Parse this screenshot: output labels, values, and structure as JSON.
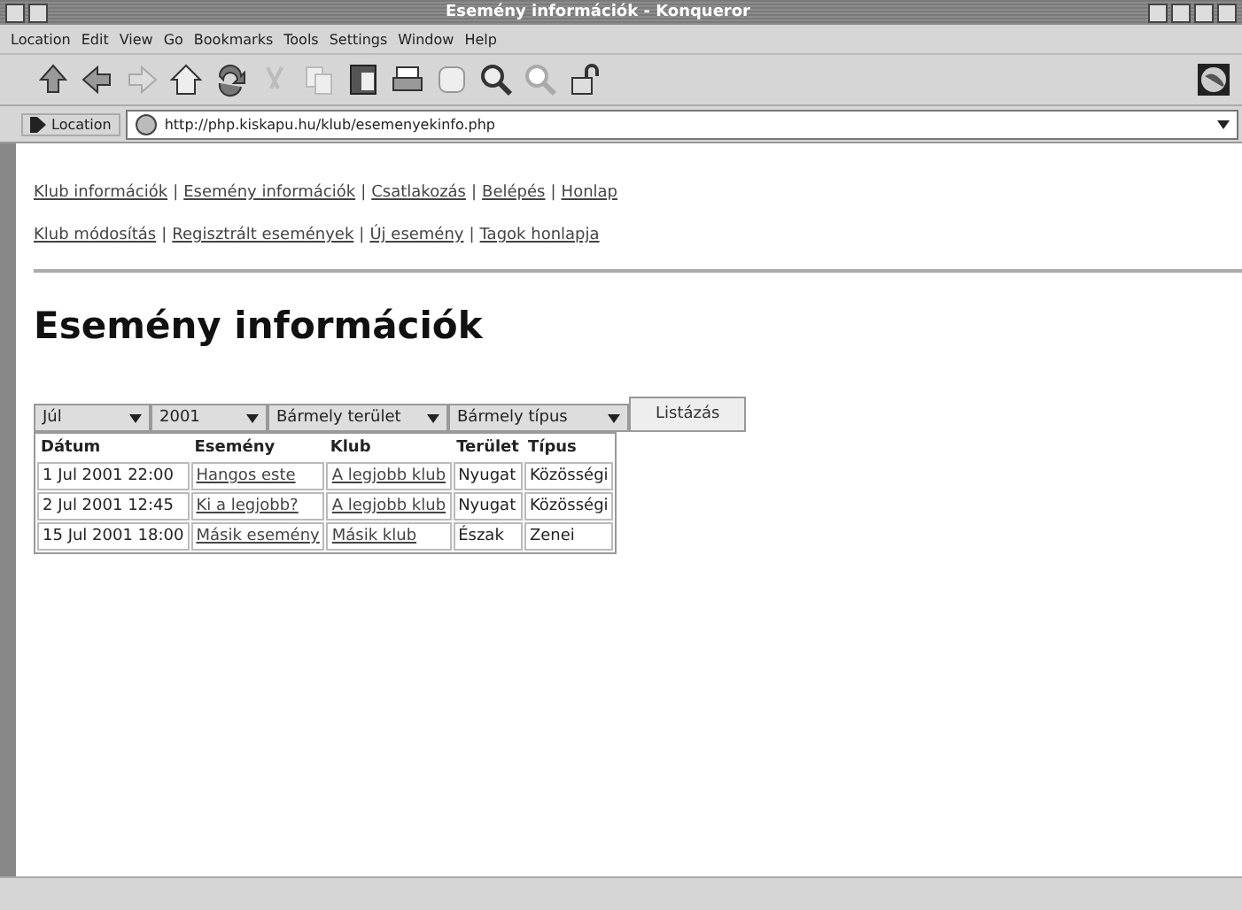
{
  "window": {
    "title": "Esemény információk - Konqueror"
  },
  "menu": [
    "Location",
    "Edit",
    "View",
    "Go",
    "Bookmarks",
    "Tools",
    "Settings",
    "Window",
    "Help"
  ],
  "location_bar": {
    "label": "Location",
    "url": "http://php.kiskapu.hu/klub/esemenyekinfo.php"
  },
  "nav_rows": [
    {
      "separator": "|",
      "links": [
        "Klub információk",
        "Esemény információk",
        "Csatlakozás",
        "Belépés",
        "Honlap"
      ]
    },
    {
      "separator": "|",
      "links": [
        "Klub módosítás",
        "Regisztrált események",
        "Új esemény",
        "Tagok honlapja"
      ]
    }
  ],
  "heading": "Esemény információk",
  "filters": [
    "Júl",
    "2001",
    "Bármely terület",
    "Bármely típus"
  ],
  "list_button": "Listázás",
  "table": {
    "columns": [
      "Dátum",
      "Esemény",
      "Klub",
      "Terület",
      "Típus"
    ],
    "rows": [
      [
        "1 Jul 2001 22:00",
        "Hangos este",
        "A legjobb klub",
        "Nyugat",
        "Közösségi"
      ],
      [
        "2 Jul 2001 12:45",
        "Ki a legjobb?",
        "A legjobb klub",
        "Nyugat",
        "Közösségi"
      ],
      [
        "15 Jul 2001 18:00",
        "Másik esemény",
        "Másik klub",
        "Észak",
        "Zenei"
      ]
    ]
  }
}
